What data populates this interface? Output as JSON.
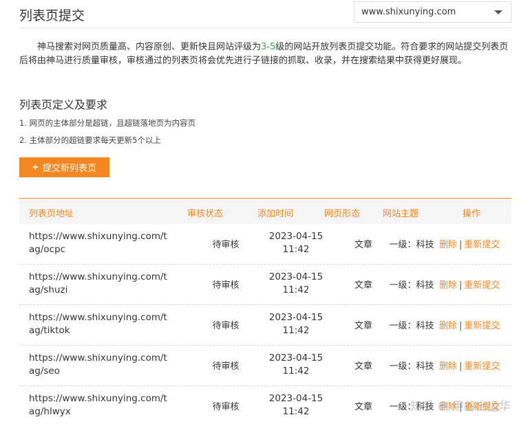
{
  "header": {
    "title": "列表页提交"
  },
  "site_select": {
    "value": "www.shixunying.com"
  },
  "intro": {
    "before": "神马搜索对网页质量高、内容原创、更新快且网站评级为",
    "highlight": "3-5",
    "after": "级的网站开放列表页提交功能。符合要求的网站提交列表页后将由神马进行质量审核，审核通过的列表页将会优先进行子链接的抓取、收录，并在搜索结果中获得更好展现。"
  },
  "section": {
    "title": "列表页定义及要求",
    "requirements": [
      "1. 网页的主体部分是超链，且超链落地页为内容页",
      "2. 主体部分的超链要求每天更新5个以上"
    ]
  },
  "submit_button": {
    "label": "提交新列表页"
  },
  "table": {
    "columns": [
      "列表页地址",
      "审核状态",
      "添加时间",
      "网页形态",
      "网站主题",
      "操作"
    ],
    "rows": [
      {
        "url": "https://www.shixunying.com/tag/ocpc",
        "status": "待审核",
        "date": "2023-04-15",
        "time": "11:42",
        "form": "文章",
        "topic": "一级：科技",
        "delete": "删除",
        "resubmit": "重新提交"
      },
      {
        "url": "https://www.shixunying.com/tag/shuzi",
        "status": "待审核",
        "date": "2023-04-15",
        "time": "11:42",
        "form": "文章",
        "topic": "一级：科技",
        "delete": "删除",
        "resubmit": "重新提交"
      },
      {
        "url": "https://www.shixunying.com/tag/tiktok",
        "status": "待审核",
        "date": "2023-04-15",
        "time": "11:42",
        "form": "文章",
        "topic": "一级：科技",
        "delete": "删除",
        "resubmit": "重新提交"
      },
      {
        "url": "https://www.shixunying.com/tag/seo",
        "status": "待审核",
        "date": "2023-04-15",
        "time": "11:42",
        "form": "文章",
        "topic": "一级：科技",
        "delete": "删除",
        "resubmit": "重新提交"
      },
      {
        "url": "https://www.shixunying.com/tag/hlwyx",
        "status": "待审核",
        "date": "2023-04-15",
        "time": "11:42",
        "form": "文章",
        "topic": "一级：科技",
        "delete": "删除",
        "resubmit": "重新提交"
      }
    ],
    "separator": "|"
  },
  "watermark": {
    "site": "知乎",
    "at": "@",
    "author": "甲谷出运华"
  },
  "colors": {
    "accent": "#f4871f",
    "highlight": "#38a743"
  }
}
